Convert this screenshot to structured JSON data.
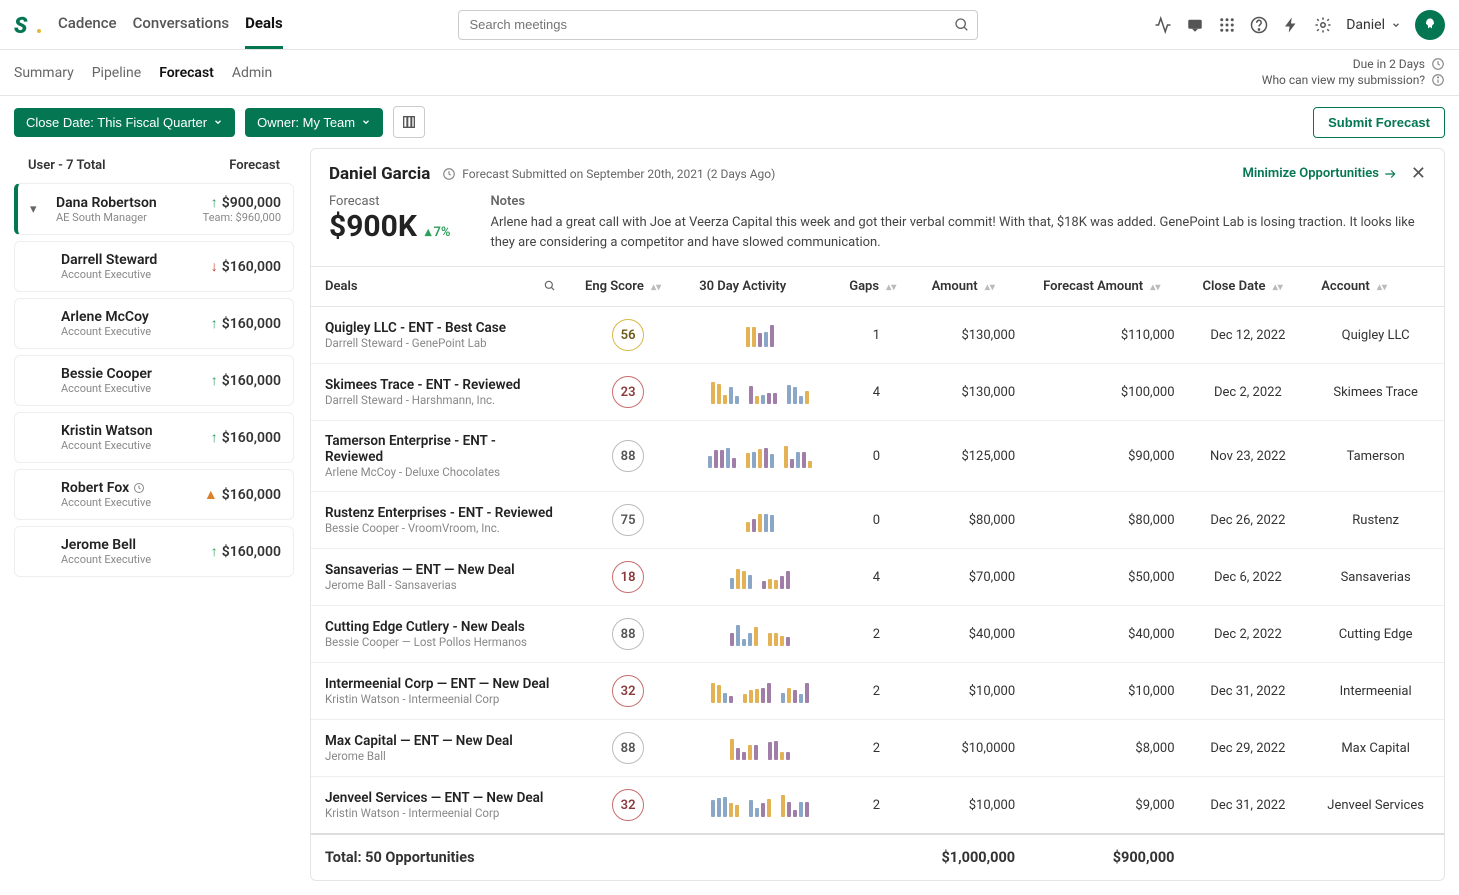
{
  "nav": {
    "items": [
      "Cadence",
      "Conversations",
      "Deals"
    ],
    "active": 2,
    "search_placeholder": "Search meetings",
    "user_name": "Daniel"
  },
  "subnav": {
    "items": [
      "Summary",
      "Pipeline",
      "Forecast",
      "Admin"
    ],
    "active": 2,
    "due_text": "Due in 2 Days",
    "who_text": "Who can view my submission?"
  },
  "filters": {
    "close_date": "Close Date: This Fiscal Quarter",
    "owner": "Owner: My Team",
    "submit_label": "Submit Forecast"
  },
  "sidebar": {
    "header_left": "User - 7 Total",
    "header_right": "Forecast",
    "lead": {
      "name": "Dana Robertson",
      "role": "AE South Manager",
      "amount": "$900,000",
      "team": "Team: $960,000",
      "trend": "up"
    },
    "users": [
      {
        "name": "Darrell Steward",
        "role": "Account Executive",
        "amount": "$160,000",
        "trend": "down"
      },
      {
        "name": "Arlene McCoy",
        "role": "Account Executive",
        "amount": "$160,000",
        "trend": "up"
      },
      {
        "name": "Bessie Cooper",
        "role": "Account Executive",
        "amount": "$160,000",
        "trend": "up"
      },
      {
        "name": "Kristin Watson",
        "role": "Account Executive",
        "amount": "$160,000",
        "trend": "up"
      },
      {
        "name": "Robert Fox",
        "role": "Account Executive",
        "amount": "$160,000",
        "trend": "warn",
        "clock": true
      },
      {
        "name": "Jerome Bell",
        "role": "Account Executive",
        "amount": "$160,000",
        "trend": "up"
      }
    ]
  },
  "detail": {
    "name": "Daniel Garcia",
    "submitted": "Forecast Submitted on September 20th, 2021 (2 Days Ago)",
    "minimize": "Minimize Opportunities",
    "forecast_label": "Forecast",
    "forecast_value": "$900K",
    "forecast_delta": "7%",
    "notes_label": "Notes",
    "notes_text": "Arlene had a great call with Joe at Veerza Capital this week and got their verbal commit! With that, $18K was added. GenePoint Lab is losing traction. It looks like they are considering a competitor and have slowed communication."
  },
  "table": {
    "columns": [
      "Deals",
      "Eng Score",
      "30 Day Activity",
      "Gaps",
      "Amount",
      "Forecast Amount",
      "Close Date",
      "Account"
    ],
    "rows": [
      {
        "deal": "Quigley LLC - ENT - Best Case",
        "sub": "Darrell Steward - GenePoint Lab",
        "score": 56,
        "score_cls": "yellow",
        "gaps": "1",
        "amount": "$130,000",
        "forecast": "$110,000",
        "close": "Dec 12, 2022",
        "account": "Quigley LLC",
        "spark": 1
      },
      {
        "deal": "Skimees Trace - ENT - Reviewed",
        "sub": "Darrell Steward - Harshmann, Inc.",
        "score": 23,
        "score_cls": "red",
        "gaps": "4",
        "amount": "$130,000",
        "forecast": "$100,000",
        "close": "Dec 2, 2022",
        "account": "Skimees Trace",
        "spark": 3
      },
      {
        "deal": "Tamerson Enterprise - ENT - Reviewed",
        "sub": "Arlene McCoy - Deluxe Chocolates",
        "score": 88,
        "score_cls": "grey",
        "gaps": "0",
        "amount": "$125,000",
        "forecast": "$90,000",
        "close": "Nov 23, 2022",
        "account": "Tamerson",
        "spark": 3
      },
      {
        "deal": "Rustenz Enterprises - ENT - Reviewed",
        "sub": "Bessie Cooper - VroomVroom, Inc.",
        "score": 75,
        "score_cls": "grey",
        "gaps": "0",
        "amount": "$80,000",
        "forecast": "$80,000",
        "close": "Dec 26, 2022",
        "account": "Rustenz",
        "spark": 1
      },
      {
        "deal": "Sansaverias — ENT — New Deal",
        "sub": "Jerome Ball - Sansaverias",
        "score": 18,
        "score_cls": "red",
        "gaps": "4",
        "amount": "$70,000",
        "forecast": "$50,000",
        "close": "Dec 6, 2022",
        "account": "Sansaverias",
        "spark": 2
      },
      {
        "deal": "Cutting Edge Cutlery - New Deals",
        "sub": "Bessie Cooper — Lost Pollos Hermanos",
        "score": 88,
        "score_cls": "grey",
        "gaps": "2",
        "amount": "$40,000",
        "forecast": "$40,000",
        "close": "Dec 2, 2022",
        "account": "Cutting Edge",
        "spark": 2
      },
      {
        "deal": "Intermeenial Corp — ENT — New Deal",
        "sub": "Kristin Watson - Intermeenial Corp",
        "score": 32,
        "score_cls": "red",
        "gaps": "2",
        "amount": "$10,000",
        "forecast": "$10,000",
        "close": "Dec 31, 2022",
        "account": "Intermeenial",
        "spark": 3
      },
      {
        "deal": "Max Capital — ENT — New Deal",
        "sub": "Jerome Ball",
        "score": 88,
        "score_cls": "grey",
        "gaps": "2",
        "amount": "$10,0000",
        "forecast": "$8,000",
        "close": "Dec 29, 2022",
        "account": "Max Capital",
        "spark": 2
      },
      {
        "deal": "Jenveel Services — ENT — New Deal",
        "sub": "Kristin Watson - Intermeenial Corp",
        "score": 32,
        "score_cls": "red",
        "gaps": "2",
        "amount": "$10,000",
        "forecast": "$9,000",
        "close": "Dec 31, 2022",
        "account": "Jenveel Services",
        "spark": 3
      }
    ],
    "totals": {
      "label": "Total: 50 Opportunities",
      "amount": "$1,000,000",
      "forecast": "$900,000"
    }
  }
}
